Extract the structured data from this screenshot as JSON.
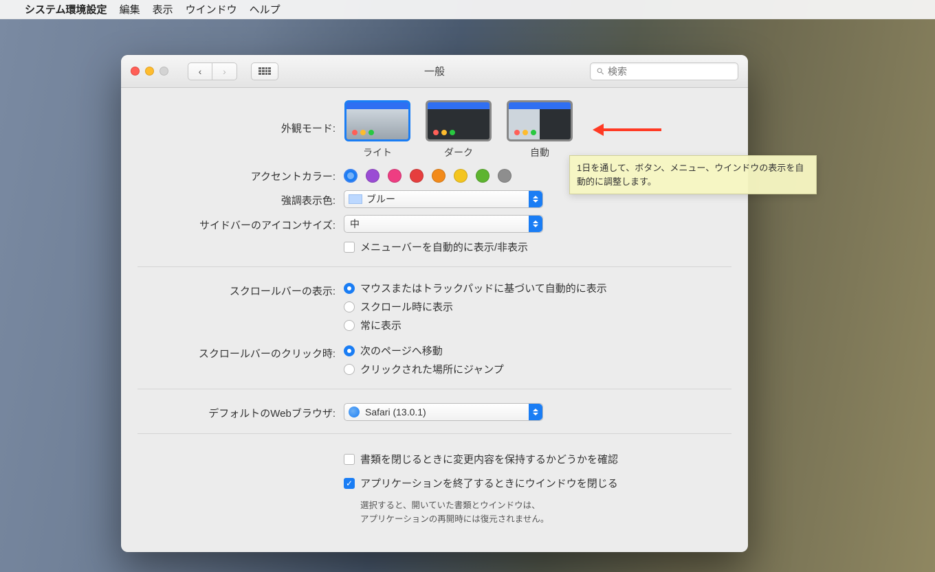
{
  "menubar": {
    "app": "システム環境設定",
    "items": [
      "編集",
      "表示",
      "ウインドウ",
      "ヘルプ"
    ]
  },
  "window": {
    "title": "一般",
    "search_placeholder": "検索"
  },
  "labels": {
    "appearance": "外観モード:",
    "accent": "アクセントカラー:",
    "highlight": "強調表示色:",
    "sidebar_icon": "サイドバーのアイコンサイズ:",
    "menubar_autohide": "メニューバーを自動的に表示/非表示",
    "scroll_show": "スクロールバーの表示:",
    "scroll_click": "スクロールバーのクリック時:",
    "default_browser": "デフォルトのWebブラウザ:",
    "ask_keep_changes": "書類を閉じるときに変更内容を保持するかどうかを確認",
    "close_windows": "アプリケーションを終了するときにウインドウを閉じる",
    "note1": "選択すると、開いていた書類とウインドウは、",
    "note2": "アプリケーションの再開時には復元されません。"
  },
  "appearance_options": [
    "ライト",
    "ダーク",
    "自動"
  ],
  "accent_colors": [
    "#1a7df4",
    "#9a4cd4",
    "#ee3d82",
    "#e63e3e",
    "#f28a1a",
    "#f4c51e",
    "#5db42f",
    "#8e8e8e"
  ],
  "highlight_value": "ブルー",
  "sidebar_value": "中",
  "scroll_show_options": [
    "マウスまたはトラックパッドに基づいて自動的に表示",
    "スクロール時に表示",
    "常に表示"
  ],
  "scroll_click_options": [
    "次のページへ移動",
    "クリックされた場所にジャンプ"
  ],
  "browser_value": "Safari (13.0.1)",
  "tooltip": "1日を通して、ボタン、メニュー、ウインドウの表示を自動的に調整します。"
}
